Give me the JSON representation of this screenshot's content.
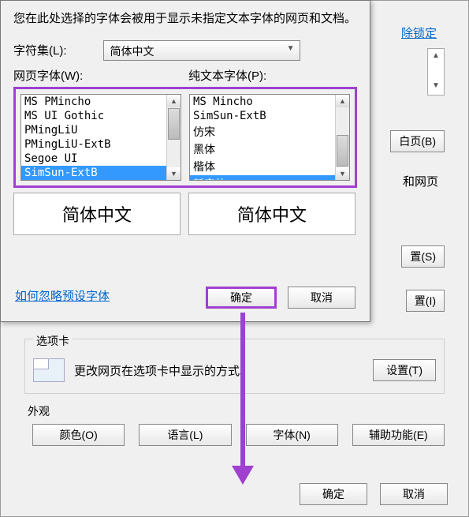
{
  "front": {
    "desc": "您在此处选择的字体会被用于显示未指定文本字体的网页和文档。",
    "charset_label": "字符集(L):",
    "charset_value": "简体中文",
    "web_font_label": "网页字体(W):",
    "plain_font_label": "纯文本字体(P):",
    "web_fonts": [
      "MS PMincho",
      "MS UI Gothic",
      "PMingLiU",
      "PMingLiU-ExtB",
      "Segoe UI",
      "SimSun-ExtB"
    ],
    "plain_fonts": [
      "MS Mincho",
      "SimSun-ExtB",
      "仿宋",
      "黑体",
      "楷体",
      "新宋体"
    ],
    "web_selected": "SimSun-ExtB",
    "plain_selected": "新宋体",
    "preview_left": "简体中文",
    "preview_right": "简体中文",
    "link": "如何忽略预设字体",
    "ok": "确定",
    "cancel": "取消"
  },
  "bg": {
    "lock": "除锁定",
    "blank_btn": "白页(B)",
    "pages_label": "和网页",
    "btn_s": "置(S)",
    "btn_i": "置(I)",
    "tabs_group": "选项卡",
    "tabs_text": "更改网页在选项卡中显示的方式。",
    "tabs_btn": "设置(T)",
    "appearance_group": "外观",
    "color_btn": "颜色(O)",
    "lang_btn": "语言(L)",
    "font_btn": "字体(N)",
    "access_btn": "辅助功能(E)",
    "ok": "确定",
    "cancel": "取消"
  }
}
